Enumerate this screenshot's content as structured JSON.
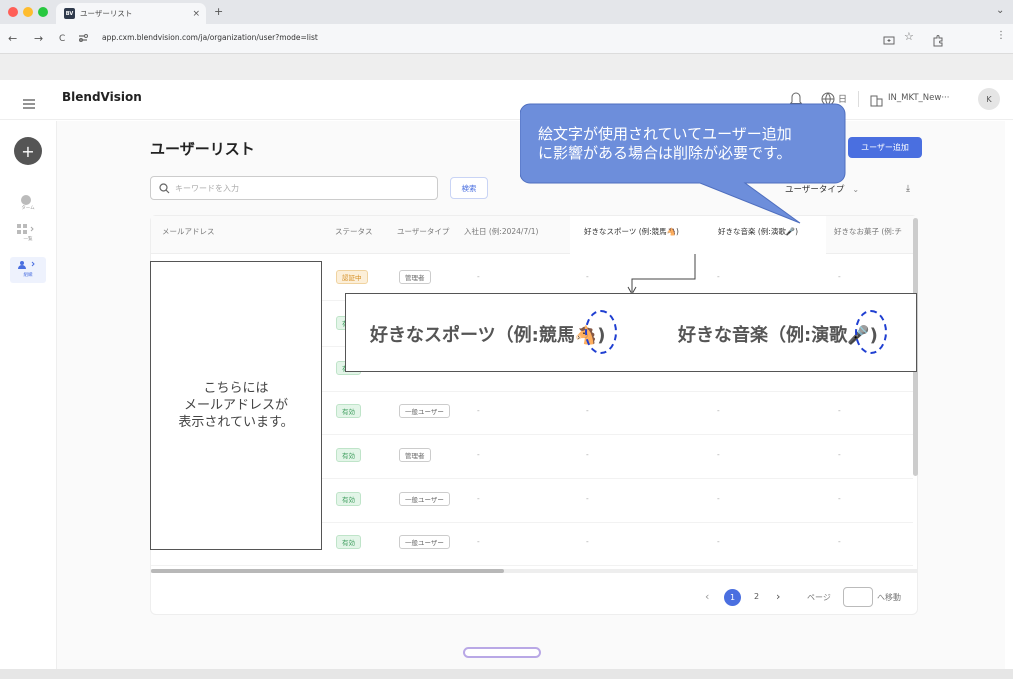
{
  "browser": {
    "tab_title": "ユーザーリスト",
    "tab_close": "×",
    "new_tab": "+",
    "url": "app.cxm.blendvision.com/ja/organization/user?mode=list",
    "back": "←",
    "forward": "→",
    "reload": "C",
    "chevron": "⌄"
  },
  "app": {
    "brand": "BlendVision",
    "account": "IN_MKT_New···",
    "avatar": "K"
  },
  "sidebar": {
    "items": [
      {
        "label": "ターム"
      },
      {
        "label": "一覧"
      },
      {
        "label": "組織"
      }
    ]
  },
  "page": {
    "title": "ユーザーリスト",
    "search_placeholder": "キーワードを入力",
    "search_button": "検索",
    "add_user_button": "ユーザー追加",
    "user_type_filter": "ユーザータイプ"
  },
  "table": {
    "headers": [
      "メールアドレス",
      "ステータス",
      "ユーザータイプ",
      "入社日 (例:2024/7/1)",
      "好きなスポーツ (例:競馬🐴)",
      "好きな音楽 (例:演歌🎤)",
      "好きなお菓子 (例:チ"
    ],
    "rows": [
      {
        "status": "認証中",
        "status_kind": "orange",
        "type": "管理者",
        "date": "-"
      },
      {
        "status": "有効",
        "status_kind": "green",
        "type": "",
        "date": ""
      },
      {
        "status": "有効",
        "status_kind": "green",
        "type": "",
        "date": ""
      },
      {
        "status": "有効",
        "status_kind": "green",
        "type": "一般ユーザー",
        "date": "-"
      },
      {
        "status": "有効",
        "status_kind": "green",
        "type": "管理者",
        "date": "-"
      },
      {
        "status": "有効",
        "status_kind": "green",
        "type": "一般ユーザー",
        "date": "-"
      },
      {
        "status": "有効",
        "status_kind": "green",
        "type": "一般ユーザー",
        "date": "-"
      }
    ],
    "dash": "-"
  },
  "annotations": {
    "email_note": "こちらには\nメールアドレスが\n表示されています。",
    "callout": "絵文字が使用されていてユーザー追加\nに影響がある場合は削除が必要です。",
    "zoom_sport": "好きなスポーツ（例:競馬",
    "zoom_sport_emoji": "🐴",
    "zoom_music": "好きな音楽（例:演歌",
    "zoom_music_emoji": "🎤",
    "zoom_close": ")"
  },
  "pagination": {
    "prev": "‹",
    "pages": [
      "1",
      "2"
    ],
    "next": "›",
    "page_label": "ページ",
    "go_label": "へ移動"
  },
  "colors": {
    "primary": "#4a6fe0",
    "callout": "#6d8edb",
    "highlight": "#1f3fd1"
  }
}
